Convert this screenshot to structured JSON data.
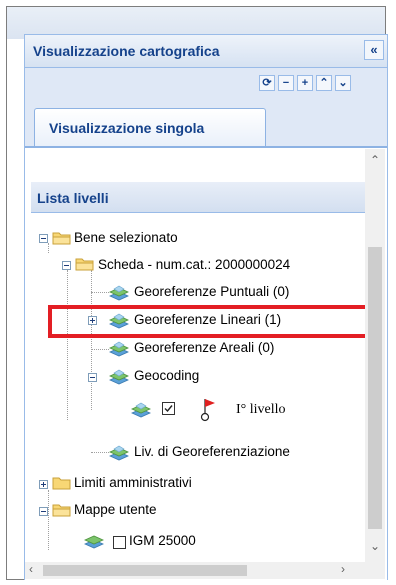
{
  "panel": {
    "title": "Visualizzazione cartografica",
    "collapse_icon": "double-chevron-left-icon"
  },
  "toolbar": {
    "icons": [
      "refresh-icon",
      "minus-icon",
      "plus-icon",
      "collapse-up-icon",
      "expand-down-icon"
    ]
  },
  "tabs": [
    {
      "label": "Visualizzazione singola",
      "active": true
    }
  ],
  "layer_list": {
    "title": "Lista livelli"
  },
  "tree": {
    "bene": {
      "label": "Bene selezionato",
      "expanded": true
    },
    "scheda": {
      "label": "Scheda - num.cat.: 2000000024",
      "expanded": true
    },
    "puntuali": {
      "label": "Georeferenze Puntuali (0)"
    },
    "lineari": {
      "label": "Georeferenze Lineari (1)",
      "expanded": false,
      "highlighted": true
    },
    "areali": {
      "label": "Georeferenze Areali (0)"
    },
    "geocoding": {
      "label": "Geocoding",
      "expanded": true
    },
    "livello1": {
      "label": "I° livello",
      "checked": true
    },
    "liv_geo": {
      "label": "Liv. di Georeferenziazione"
    },
    "limiti": {
      "label": "Limiti amministrativi",
      "expanded": false
    },
    "mappe": {
      "label": "Mappe utente",
      "expanded": true
    },
    "igm": {
      "label": "IGM 25000",
      "checked": false
    }
  },
  "colors": {
    "header_text": "#15428b",
    "highlight": "#e31e24",
    "panel_border": "#99bbe8"
  }
}
